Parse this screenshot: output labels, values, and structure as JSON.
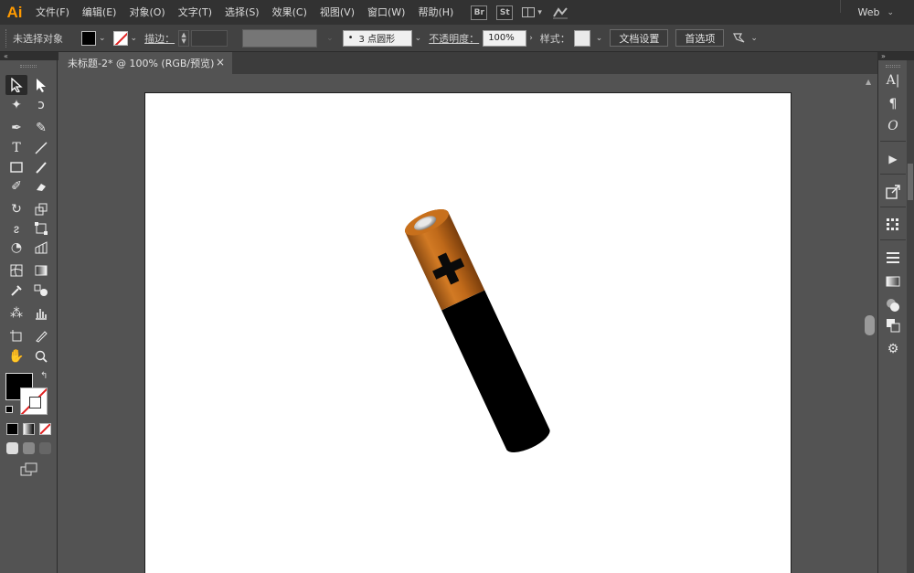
{
  "app": {
    "logo": "Ai"
  },
  "menu": [
    "文件(F)",
    "编辑(E)",
    "对象(O)",
    "文字(T)",
    "选择(S)",
    "效果(C)",
    "视图(V)",
    "窗口(W)",
    "帮助(H)"
  ],
  "menu_icons": {
    "bridge": "Br",
    "stock": "St"
  },
  "workspace": {
    "label": "Web"
  },
  "control_bar": {
    "selection_status": "未选择对象",
    "stroke_label": "描边：",
    "brush_value": "3 点圆形",
    "opacity_label": "不透明度：",
    "opacity_value": "100%",
    "style_label": "样式：",
    "doc_settings_button": "文档设置",
    "preferences_button": "首选项"
  },
  "document_tab": {
    "title": "未标题-2* @ 100% (RGB/预览)",
    "close": "×"
  },
  "colors": {
    "fill": "#000000",
    "stroke": "none",
    "battery_body": "#000000",
    "battery_cap": "#c8701c",
    "battery_terminal": "#e8e8e8",
    "app_accent": "#ff9a00"
  },
  "artwork": {
    "description_visible": false
  }
}
